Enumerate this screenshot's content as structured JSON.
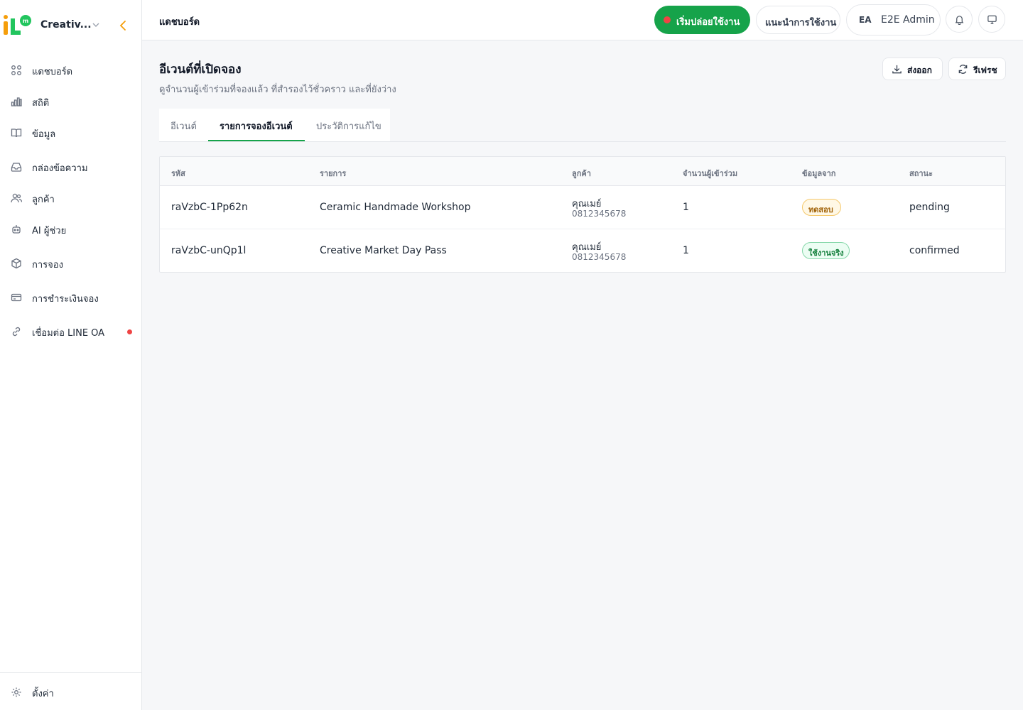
{
  "brand": {
    "name": "Creativ...",
    "logo_text": "iL",
    "logo_badge": "m"
  },
  "sidebar": {
    "items": [
      {
        "label": "แดชบอร์ด",
        "icon": "grid-icon"
      },
      {
        "label": "สถิติ",
        "icon": "bar-chart-icon"
      },
      {
        "label": "ข้อมูล",
        "icon": "book-icon"
      },
      {
        "label": "กล่องข้อความ",
        "icon": "inbox-icon"
      },
      {
        "label": "ลูกค้า",
        "icon": "users-icon"
      },
      {
        "label": "AI ผู้ช่วย",
        "icon": "bot-icon"
      },
      {
        "label": "การจอง",
        "icon": "package-icon"
      },
      {
        "label": "การชำระเงินจอง",
        "icon": "credit-card-icon"
      },
      {
        "label": "เชื่อมต่อ LINE OA",
        "icon": "link-icon",
        "alert": true
      }
    ],
    "settings_label": "ตั้งค่า"
  },
  "header": {
    "title": "แดชบอร์ด",
    "launch_label": "เริ่มปล่อยใช้งาน",
    "guide_label": "แนะนำการใช้งาน",
    "user_initials": "EA",
    "user_name": "E2E Admin"
  },
  "page": {
    "title": "อีเวนต์ที่เปิดจอง",
    "subtitle": "ดูจำนวนผู้เข้าร่วมที่จองแล้ว ที่สำรองไว้ชั่วคราว และที่ยังว่าง",
    "export_label": "ส่งออก",
    "refresh_label": "รีเฟรช"
  },
  "tabs": [
    {
      "label": "อีเวนต์",
      "active": false
    },
    {
      "label": "รายการจองอีเวนต์",
      "active": true
    },
    {
      "label": "ประวัติการแก้ไข",
      "active": false
    }
  ],
  "table": {
    "columns": [
      "รหัส",
      "รายการ",
      "ลูกค้า",
      "จำนวนผู้เข้าร่วม",
      "ข้อมูลจาก",
      "สถานะ"
    ],
    "rows": [
      {
        "code": "raVzbC-1Pp62n",
        "item": "Ceramic Handmade Workshop",
        "customer_name": "คุณเมย์",
        "customer_phone": "0812345678",
        "attendees": "1",
        "source": "ทดสอบ",
        "source_type": "test",
        "status": "pending"
      },
      {
        "code": "raVzbC-unQp1l",
        "item": "Creative Market Day Pass",
        "customer_name": "คุณเมย์",
        "customer_phone": "0812345678",
        "attendees": "1",
        "source": "ใช้งานจริง",
        "source_type": "live",
        "status": "confirmed"
      }
    ]
  },
  "colors": {
    "accent": "#16a34a",
    "alert": "#ef4444",
    "logo_orange": "#f59e0b",
    "logo_green": "#22c55e"
  }
}
